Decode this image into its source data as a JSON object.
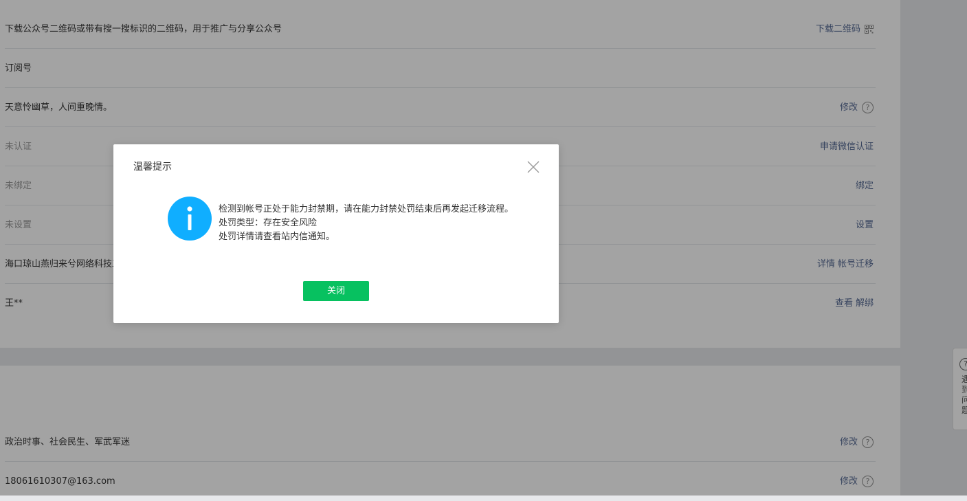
{
  "rows_top": [
    {
      "value": "下载公众号二维码或带有搜一搜标识的二维码，用于推广与分享公众号",
      "action": "下载二维码",
      "extra_icon": "qr-code-icon"
    },
    {
      "value": "订阅号",
      "action": ""
    },
    {
      "value": "天意怜幽草，人间重晚情。",
      "action": "修改",
      "extra_icon": "question-icon"
    },
    {
      "value": "未认证",
      "action": "申请微信认证"
    },
    {
      "value": "未绑定",
      "action": "绑定"
    },
    {
      "value": "未设置",
      "action": "设置"
    },
    {
      "value": "海口琼山燕归来兮网络科技工",
      "action": "详情",
      "action2": "帐号迁移"
    },
    {
      "value": "王**",
      "action": "查看",
      "action2": "解绑"
    }
  ],
  "rows_bottom": [
    {
      "value": "政治时事、社会民生、军武军迷",
      "action": "修改",
      "extra_icon": "question-icon"
    },
    {
      "value": "18061610307@163.com",
      "action": "修改",
      "extra_icon": "question-icon"
    }
  ],
  "side_help": {
    "icon": "?",
    "text": "遇到问题"
  },
  "dialog": {
    "title": "温馨提示",
    "lines": [
      "检测到帐号正处于能力封禁期，请在能力封禁处罚结束后再发起迁移流程。",
      "处罚类型：存在安全风险",
      "处罚详情请查看站内信通知。"
    ],
    "close_button": "关闭"
  },
  "colors": {
    "link": "#576b95",
    "primary_button": "#07c160",
    "info_icon": "#10aeff",
    "mask": "rgba(0,0,0,0.36)"
  }
}
